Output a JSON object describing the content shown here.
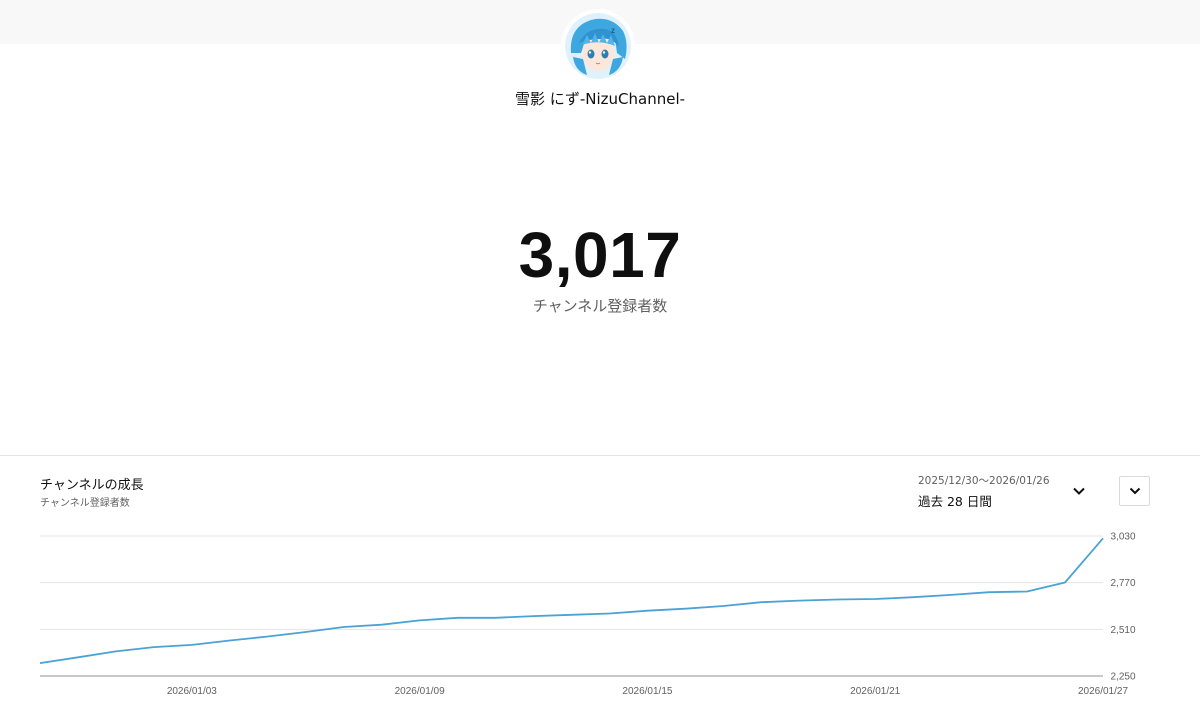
{
  "header": {
    "channel_name": "雪影 にず-NizuChannel-",
    "avatar_icon": "anime-avatar-icon"
  },
  "stats": {
    "subscriber_count": "3,017",
    "subscriber_label": "チャンネル登録者数"
  },
  "growth_card": {
    "title": "チャンネルの成長",
    "subtitle": "チャンネル登録者数",
    "period_range": "2025/12/30〜2026/01/26",
    "period_label": "過去 28 日間",
    "period_dropdown_icon": "chevron-down-icon",
    "menu_icon": "chevron-down-icon"
  },
  "colors": {
    "line": "#4aa3d4",
    "grid": "#e5e5e5",
    "axis": "#909090"
  },
  "chart_data": {
    "type": "line",
    "title": "",
    "xlabel": "",
    "ylabel": "",
    "grid": true,
    "ylim": [
      2250,
      3030
    ],
    "yticks": [
      2250,
      2510,
      2770,
      3030
    ],
    "ytick_labels": [
      "2,250",
      "2,510",
      "2,770",
      "3,030"
    ],
    "xtick_labels": [
      "2026/01/03",
      "2026/01/09",
      "2026/01/15",
      "2026/01/21",
      "2026/01/27"
    ],
    "xtick_dates": [
      "2026-01-03",
      "2026-01-09",
      "2026-01-15",
      "2026-01-21",
      "2026-01-27"
    ],
    "x": [
      "2025-12-30",
      "2025-12-31",
      "2026-01-01",
      "2026-01-02",
      "2026-01-03",
      "2026-01-04",
      "2026-01-05",
      "2026-01-06",
      "2026-01-07",
      "2026-01-08",
      "2026-01-09",
      "2026-01-10",
      "2026-01-11",
      "2026-01-12",
      "2026-01-13",
      "2026-01-14",
      "2026-01-15",
      "2026-01-16",
      "2026-01-17",
      "2026-01-18",
      "2026-01-19",
      "2026-01-20",
      "2026-01-21",
      "2026-01-22",
      "2026-01-23",
      "2026-01-24",
      "2026-01-25",
      "2026-01-26"
    ],
    "series": [
      {
        "values": [
          2322,
          2354,
          2387,
          2411,
          2423,
          2448,
          2470,
          2495,
          2523,
          2536,
          2560,
          2574,
          2574,
          2584,
          2591,
          2598,
          2614,
          2625,
          2640,
          2661,
          2670,
          2676,
          2679,
          2689,
          2702,
          2717,
          2721,
          2771
        ]
      }
    ],
    "last_point_date": "2026-01-27",
    "last_point_value": 3017
  }
}
